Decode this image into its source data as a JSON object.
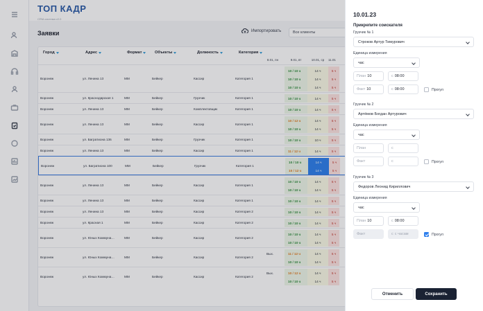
{
  "app": {
    "brand": "ТОП КАДР",
    "brand_sub": "CRM-система v2.0"
  },
  "page": {
    "title": "Заявки",
    "import_label": "Импортировать",
    "clients_select": "Все клиенты"
  },
  "table": {
    "columns": [
      {
        "key": "city",
        "label": "Город"
      },
      {
        "key": "address",
        "label": "Адрес"
      },
      {
        "key": "format",
        "label": "Формат"
      },
      {
        "key": "objects",
        "label": "Объекты"
      },
      {
        "key": "position",
        "label": "Должность"
      },
      {
        "key": "category",
        "label": "Категория"
      }
    ],
    "dates": [
      "8.01, пн",
      "9.01, вт",
      "10.01, ср",
      "11.01"
    ],
    "rows": [
      {
        "city": "Воронеж",
        "address": "ул. Ленина 13",
        "format": "ММ",
        "objects": "Бейкер",
        "position": "Кассир",
        "category": "Категория 1",
        "subs": [
          {
            "d9": "10 / 10 ч",
            "d9c": "g",
            "d10": "14 ч",
            "d11": "5 ч"
          },
          {
            "d9": "10 / 10 ч",
            "d9c": "g",
            "d10": "14 ч",
            "d11": "5 ч"
          },
          {
            "d9": "10 / 10 ч",
            "d9c": "g",
            "d10": "14 ч",
            "d11": "5 ч"
          }
        ]
      },
      {
        "city": "Воронеж",
        "address": "ул. Краснодарская 1",
        "format": "ММ",
        "objects": "Бейкер",
        "position": "Грузчик",
        "category": "Категория 1",
        "subs": [
          {
            "d9": "10 / 10 ч",
            "d9c": "g",
            "d10": "14 ч",
            "d11": "5 ч"
          }
        ]
      },
      {
        "city": "Воронеж",
        "address": "ул. Ленина 13",
        "format": "ММ",
        "objects": "Бейкер",
        "position": "Комплектовщик",
        "category": "Категория 1",
        "subs": [
          {
            "d9": "10 / 10 ч",
            "d9c": "g",
            "d10": "14 ч",
            "d11": "5 ч"
          }
        ]
      },
      {
        "city": "Воронеж",
        "address": "ул. Ленина 13",
        "format": "ММ",
        "objects": "Бейкер",
        "position": "Кассир",
        "category": "Категория 1",
        "subs": [
          {
            "d9": "10 / 12 ч",
            "d9c": "o",
            "d10": "14 ч",
            "d11": "5 ч"
          },
          {
            "d9": "10 / 10 ч",
            "d9c": "g",
            "d10": "14 ч",
            "d11": "5 ч"
          }
        ]
      },
      {
        "city": "Воронеж",
        "address": "ул. Багратиона 136",
        "format": "ММ",
        "objects": "Бейкер",
        "position": "Грузчик",
        "category": "Категория 1",
        "subs": [
          {
            "d9": "10 / 10 ч",
            "d9c": "g",
            "d10": "10 ч",
            "d11": "5 ч"
          }
        ]
      },
      {
        "city": "Воронеж",
        "address": "ул. Ленина 13",
        "format": "ММ",
        "objects": "Бейкер",
        "position": "Кассир",
        "category": "Категория 1",
        "subs": [
          {
            "d9": "11 / 12 ч",
            "d9c": "o",
            "d10": "14 ч",
            "d11": "5 ч"
          }
        ]
      },
      {
        "city": "Воронеж",
        "address": "ул. Багратиона 100",
        "format": "ММ",
        "objects": "Бейкер",
        "position": "Грузчик",
        "category": "Категория 1",
        "highlight": true,
        "subs": [
          {
            "d9": "10 / 10 ч",
            "d9c": "g",
            "d10": "14 ч",
            "d11": "5 ч",
            "blue": true
          },
          {
            "d9": "10 / 12 ч",
            "d9c": "o",
            "d10": "14 ч",
            "d11": "5 ч",
            "blue": true
          }
        ]
      },
      {
        "city": "Воронеж",
        "address": "ул. Ленина 13",
        "format": "ММ",
        "objects": "Бейкер",
        "position": "Кассир",
        "category": "Категория 1",
        "subs": [
          {
            "d9": "10 / 10 ч",
            "d9c": "g",
            "d10": "14 ч",
            "d11": "5 ч"
          },
          {
            "d9": "10 / 10 ч",
            "d9c": "g",
            "d10": "14 ч",
            "d11": "5 ч"
          }
        ]
      },
      {
        "city": "Воронеж",
        "address": "ул. Ленина 13",
        "format": "ММ",
        "objects": "Бейкер",
        "position": "Кассир",
        "category": "Категория 1",
        "subs": [
          {
            "d9": "10 / 10 ч",
            "d9c": "g",
            "d10": "14 ч",
            "d11": "5 ч"
          }
        ]
      },
      {
        "city": "Воронеж",
        "address": "ул. Ленина 13",
        "format": "ММ",
        "objects": "Бейкер",
        "position": "Кассир",
        "category": "Категория 2",
        "subs": [
          {
            "d9": "10 / 10 ч",
            "d9c": "g",
            "d10": "14 ч",
            "d11": "5 ч"
          }
        ]
      },
      {
        "city": "Воронеж",
        "address": "ул. Красная 1",
        "format": "ММ",
        "objects": "Бейкер",
        "position": "Кассир",
        "category": "Категория 2",
        "subs": [
          {
            "d9": "10 / 10 ч",
            "d9c": "g",
            "d10": "14 ч",
            "d11": "5 ч"
          }
        ]
      },
      {
        "city": "Воронеж",
        "address": "ул. Юных Коммуна…",
        "format": "ММ",
        "objects": "Бейкер",
        "position": "Кассир",
        "category": "Категория 2",
        "subs": [
          {
            "d9": "10 / 10 ч",
            "d9c": "g",
            "d10": "14 ч",
            "d11": "5 ч"
          },
          {
            "d9": "10 / 10 ч",
            "d9c": "g",
            "d10": "14 ч",
            "d11": "5 ч"
          }
        ]
      },
      {
        "city": "Воронеж",
        "address": "ул. Юных Коммуна…",
        "format": "ММ",
        "objects": "Бейкер",
        "position": "Кассир",
        "category": "Категория 2",
        "subs": [
          {
            "d8": "Вых.",
            "d9": "11 / 12 ч",
            "d9c": "o",
            "d10": "14 ч",
            "d11": "5 ч"
          },
          {
            "d9": "10 / 10 ч",
            "d9c": "g",
            "d10": "14 ч",
            "d11": "5 ч"
          }
        ]
      },
      {
        "city": "Воронеж",
        "address": "ул. Юных Коммуна…",
        "format": "ММ",
        "objects": "Бейкер",
        "position": "Кассир",
        "category": "Категория 2",
        "subs": [
          {
            "d8": "Вых.",
            "d9": "10 / 12 ч",
            "d9c": "o",
            "d10": "14 ч",
            "d11": "5 ч"
          },
          {
            "d9": "10 / 10 ч",
            "d9c": "g",
            "d10": "14 ч",
            "d11": "5 ч"
          }
        ]
      }
    ]
  },
  "panel": {
    "date": "10.01.23",
    "subtitle": "Прикрепите соискателя",
    "unit_label": "Единица измерения",
    "plan_ph": "План",
    "fact_ph": "Факт",
    "from_ph": "с",
    "absence_label": "Прогул",
    "loaders": [
      {
        "label": "Грузчик № 1",
        "name": "Строков Артур Тимурович",
        "unit": "час",
        "plan": "10",
        "start": "08:00",
        "fact": "10",
        "fact_time": "08:00",
        "absent": false,
        "disabled": false
      },
      {
        "label": "Грузчик № 2",
        "name": "Артёмов Богдан Артурович",
        "unit": "час",
        "plan": "",
        "start": "",
        "fact": "",
        "fact_time": "",
        "absent": false,
        "disabled": false
      },
      {
        "label": "Грузчик № 3",
        "name": "Федоров Леонид Кириллович",
        "unit": "час",
        "plan": "10",
        "start": "08:00",
        "fact": "",
        "fact_time": "с часам",
        "absent": true,
        "disabled": true
      }
    ],
    "cancel_label": "Отменить",
    "save_label": "Сохранить"
  },
  "nav_icons": [
    "menu-icon",
    "users-icon",
    "building-icon",
    "headset-icon",
    "person-icon",
    "briefcase-icon",
    "clipboard-icon",
    "chat-icon",
    "bank-icon",
    "chart-icon"
  ]
}
